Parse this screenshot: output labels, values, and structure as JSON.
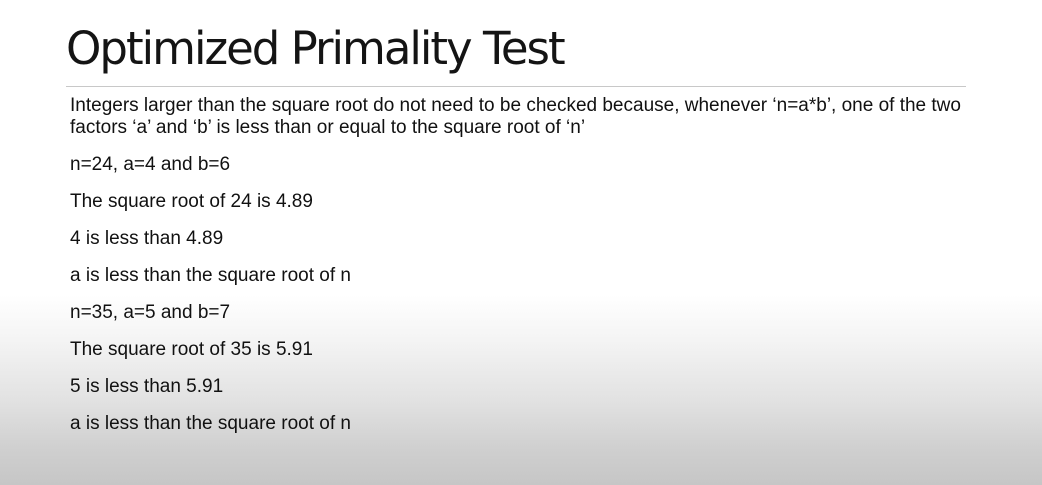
{
  "slide": {
    "title": "Optimized Primality Test",
    "intro": "Integers larger than the square root do not need to be checked because, whenever ‘n=a*b’, one of the two factors ‘a’ and ‘b’ is less than or equal to the square root of ‘n’",
    "lines": [
      "n=24, a=4 and b=6",
      "The square root of 24 is 4.89",
      "4 is less than 4.89",
      "a is less than the square root of n",
      "n=35, a=5 and b=7",
      "The square root of 35 is 5.91",
      "5 is less than 5.91",
      "a is less than the square root of n"
    ]
  }
}
